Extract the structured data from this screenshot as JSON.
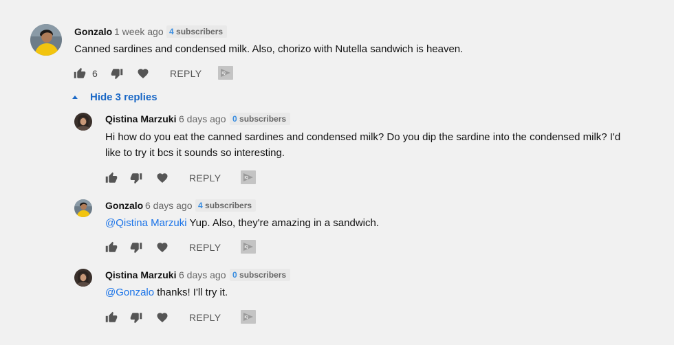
{
  "comments": [
    {
      "author": "Gonzalo",
      "time": "1 week ago",
      "subs_count": "4",
      "subs_label": "subscribers",
      "text": "Canned sardines and condensed milk. Also, chorizo with Nutella sandwich is heaven.",
      "like_count": "6",
      "reply_label": "REPLY"
    }
  ],
  "toggle": {
    "hide_label": "Hide 3 replies"
  },
  "replies": [
    {
      "author": "Qistina Marzuki",
      "time": "6 days ago",
      "subs_count": "0",
      "subs_label": "subscribers",
      "text_line1": "Hi how do you eat the canned sardines and condensed milk? Do you dip the sardine into the condensed milk? I'd",
      "text_line2": "like to try it bcs it sounds so interesting.",
      "reply_label": "REPLY"
    },
    {
      "author": "Gonzalo",
      "time": "6 days ago",
      "subs_count": "4",
      "subs_label": "subscribers",
      "mention": "@Qistina Marzuki",
      "text": " Yup. Also, they're amazing in a sandwich.",
      "reply_label": "REPLY"
    },
    {
      "author": "Qistina Marzuki",
      "time": "6 days ago",
      "subs_count": "0",
      "subs_label": "subscribers",
      "mention": "@Gonzalo",
      "text": " thanks! I'll try it.",
      "reply_label": "REPLY"
    }
  ],
  "icons": [
    "thumbs-up-icon",
    "thumbs-down-icon",
    "heart-icon",
    "extension-icon",
    "caret-up-icon"
  ],
  "colors": {
    "link": "#1a68c6",
    "subs_number": "#3b8ee0",
    "avatar_yellow": "#f2c40e"
  }
}
